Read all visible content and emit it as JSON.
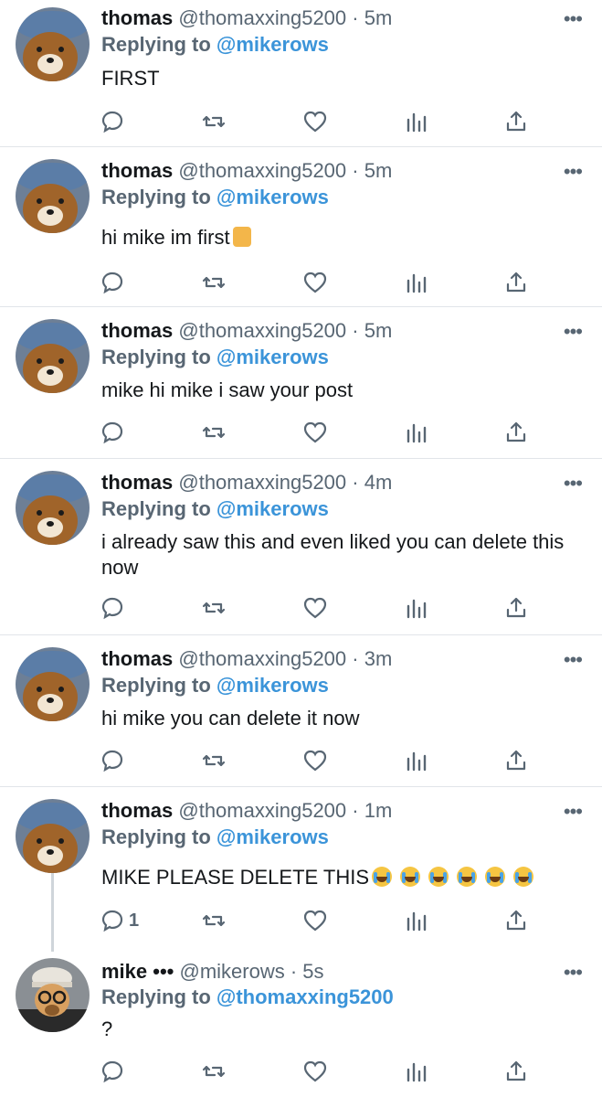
{
  "tweets": [
    {
      "name": "thomas",
      "handle": "@thomaxxing5200",
      "sep": " · ",
      "time": "5m",
      "reply_prefix": "Replying to",
      "reply_to": "@mikerows",
      "text": "FIRST",
      "reply_count": ""
    },
    {
      "name": "thomas",
      "handle": "@thomaxxing5200",
      "sep": " · ",
      "time": "5m",
      "reply_prefix": "Replying to",
      "reply_to": "@mikerows",
      "text": "hi mike im first",
      "reply_count": ""
    },
    {
      "name": "thomas",
      "handle": "@thomaxxing5200",
      "sep": " · ",
      "time": "5m",
      "reply_prefix": "Replying to",
      "reply_to": "@mikerows",
      "text": "mike hi mike i saw your post",
      "reply_count": ""
    },
    {
      "name": "thomas",
      "handle": "@thomaxxing5200",
      "sep": " · ",
      "time": "4m",
      "reply_prefix": "Replying to",
      "reply_to": "@mikerows",
      "text": "i already saw this and even liked you can delete this now",
      "reply_count": ""
    },
    {
      "name": "thomas",
      "handle": "@thomaxxing5200",
      "sep": " · ",
      "time": "3m",
      "reply_prefix": "Replying to",
      "reply_to": "@mikerows",
      "text": "hi mike you can delete it now",
      "reply_count": ""
    },
    {
      "name": "thomas",
      "handle": "@thomaxxing5200",
      "sep": " · ",
      "time": "1m",
      "reply_prefix": "Replying to",
      "reply_to": "@mikerows",
      "text": "MIKE PLEASE DELETE THIS",
      "reply_count": "1"
    },
    {
      "name": "mike •••",
      "handle": "@mikerows",
      "sep": " · ",
      "time": "5s",
      "reply_prefix": "Replying to",
      "reply_to": "@thomaxxing5200",
      "text": "?",
      "reply_count": ""
    }
  ],
  "more_glyph": "•••",
  "icons": {
    "reply": "reply-icon",
    "retweet": "retweet-icon",
    "like": "heart-icon",
    "analytics": "analytics-icon",
    "share": "share-icon",
    "more": "more-icon"
  },
  "colors": {
    "link": "#3b94d9",
    "muted": "#586673",
    "text": "#14171a",
    "divider": "#e1e5e9"
  }
}
